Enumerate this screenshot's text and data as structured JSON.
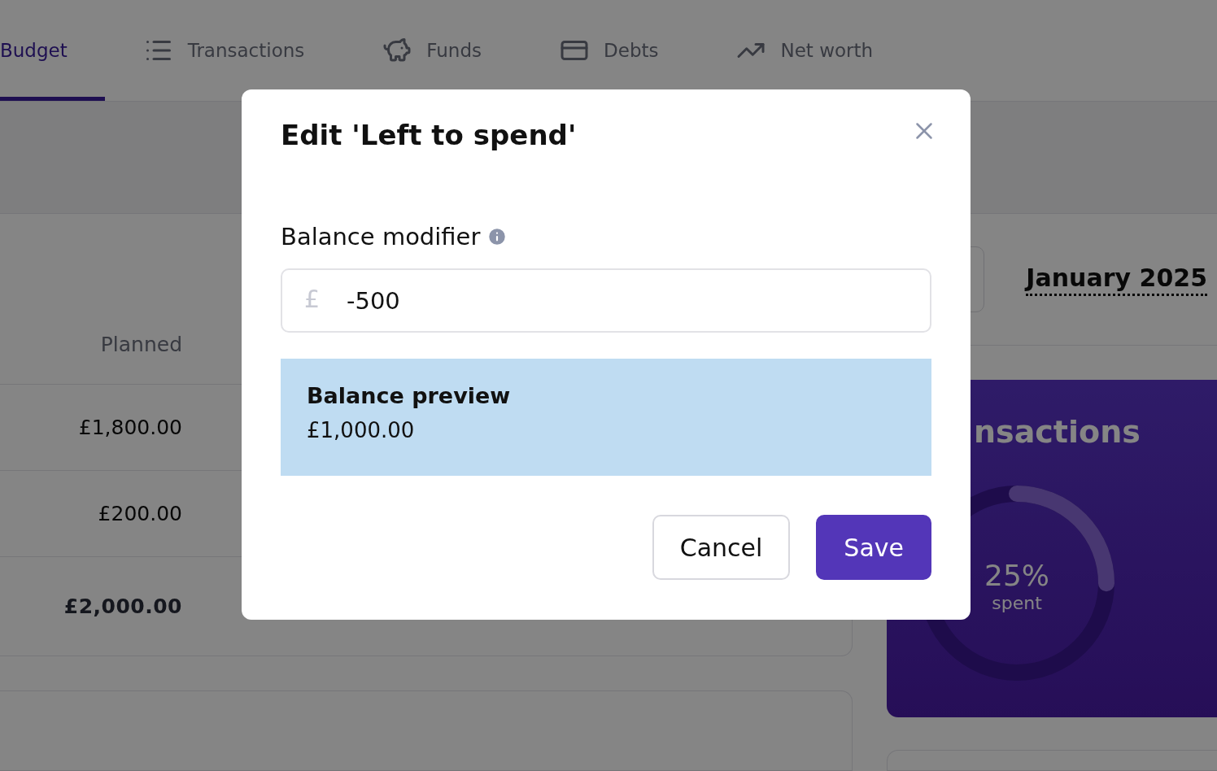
{
  "tabs": [
    {
      "label": "Budget",
      "kind": "plain",
      "selected": true
    },
    {
      "label": "Transactions",
      "kind": "list",
      "selected": false
    },
    {
      "label": "Funds",
      "kind": "piggy",
      "selected": false
    },
    {
      "label": "Debts",
      "kind": "card",
      "selected": false
    },
    {
      "label": "Net worth",
      "kind": "chart",
      "selected": false
    }
  ],
  "budget_table": {
    "column_header": "Planned",
    "rows": [
      {
        "amount": "£1,800.00",
        "total": false
      },
      {
        "amount": "£200.00",
        "total": false
      },
      {
        "amount": "£2,000.00",
        "total": true
      }
    ]
  },
  "month": "January 2025",
  "transactions_card": {
    "title": "nsactions",
    "level": 0.25,
    "percent": "25%",
    "caption": "spent"
  },
  "dialog": {
    "title": "Edit 'Left to spend'",
    "field_label": "Balance modifier",
    "currency": "£",
    "value": "-500",
    "preview_title": "Balance preview",
    "preview_value": "£1,000.00",
    "buttons": [
      {
        "label": "Cancel",
        "kind": "secondary"
      },
      {
        "label": "Save",
        "kind": "primary"
      }
    ]
  }
}
